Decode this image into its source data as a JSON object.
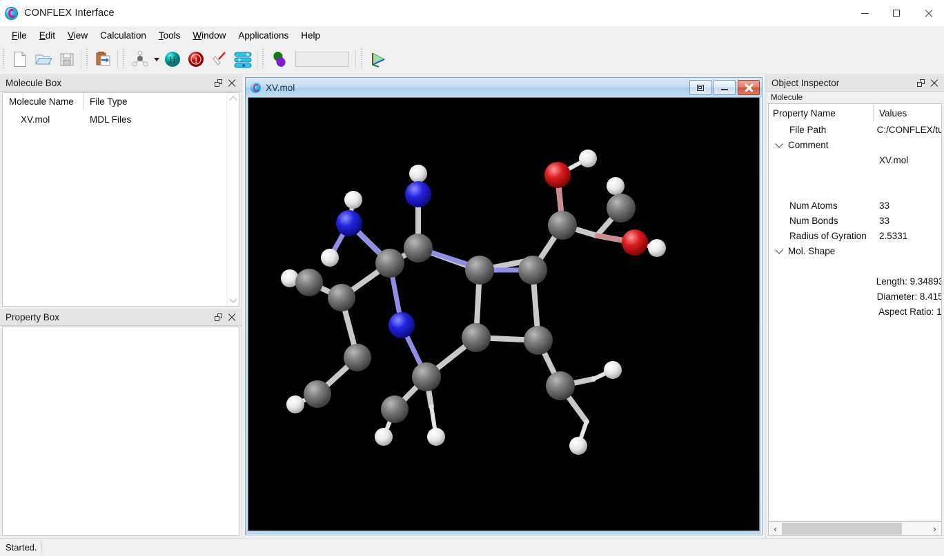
{
  "window": {
    "title": "CONFLEX Interface",
    "logo_icon": "conflex-c-logo-icon",
    "controls": {
      "minimize": "minimize-icon",
      "maximize": "maximize-icon",
      "close": "close-icon"
    }
  },
  "menubar": {
    "items": [
      {
        "label": "File",
        "mnemonic": "F"
      },
      {
        "label": "Edit",
        "mnemonic": "E"
      },
      {
        "label": "View",
        "mnemonic": "V"
      },
      {
        "label": "Calculation",
        "mnemonic": ""
      },
      {
        "label": "Tools",
        "mnemonic": "T"
      },
      {
        "label": "Window",
        "mnemonic": "W"
      },
      {
        "label": "Applications",
        "mnemonic": ""
      },
      {
        "label": "Help",
        "mnemonic": ""
      }
    ]
  },
  "toolbar": {
    "buttons": [
      {
        "name": "new-file-button",
        "icon": "new-document-icon"
      },
      {
        "name": "open-file-button",
        "icon": "open-folder-icon"
      },
      {
        "name": "save-file-button",
        "icon": "floppy-disk-save-icon"
      },
      {
        "name": "import-button",
        "icon": "import-clipboard-icon"
      },
      {
        "name": "molecule-model-button",
        "icon": "ball-stick-molecule-icon"
      },
      {
        "name": "hydrogen-button",
        "icon": "hydrogen-atom-icon",
        "glyph": "H"
      },
      {
        "name": "atom-number-button",
        "icon": "numbered-atom-icon",
        "glyph": "1"
      },
      {
        "name": "measure-button",
        "icon": "pencil-measure-icon"
      },
      {
        "name": "layers-button",
        "icon": "stacked-layers-icon"
      },
      {
        "name": "orbital-button",
        "icon": "molecular-orbital-icon"
      },
      {
        "name": "axes-button",
        "icon": "coordinate-axes-icon"
      }
    ],
    "dropdown_icon": "chevron-down-icon",
    "text_field": {
      "value": "",
      "placeholder": ""
    }
  },
  "molecule_box": {
    "title": "Molecule Box",
    "float_icon": "float-panel-icon",
    "close_icon": "close-icon",
    "columns": [
      "Molecule Name",
      "File Type"
    ],
    "rows": [
      {
        "name": "XV.mol",
        "type": "MDL Files"
      }
    ],
    "scrollbar": {
      "up_icon": "chevron-up-icon",
      "down_icon": "chevron-down-icon"
    }
  },
  "property_box": {
    "title": "Property Box",
    "float_icon": "float-panel-icon",
    "close_icon": "close-icon",
    "content": ""
  },
  "mdi_child": {
    "title": "XV.mol",
    "icon": "conflex-c-logo-icon",
    "restore_icon": "restore-window-icon",
    "minimize_icon": "minimize-icon",
    "close_icon": "close-icon",
    "viewport_background": "#000000"
  },
  "molecule_view": {
    "background": "#000000",
    "atom_colors": {
      "carbon": "#6e6e6e",
      "nitrogen": "#1a1ad8",
      "oxygen": "#cc1414",
      "hydrogen": "#f2f2f2"
    },
    "bond_color": "#c9c9c9",
    "style": "ball-and-stick"
  },
  "object_inspector": {
    "title": "Object Inspector",
    "float_icon": "float-panel-icon",
    "close_icon": "close-icon",
    "subheader": "Molecule",
    "columns": [
      "Property Name",
      "Values"
    ],
    "rows": [
      {
        "name": "File Path",
        "value": "C:/CONFLEX/tu",
        "indent": true,
        "expandable": false
      },
      {
        "name": "Comment",
        "value": "",
        "indent": true,
        "expandable": true
      },
      {
        "name": "",
        "value": "XV.mol",
        "indent": true,
        "expandable": false
      },
      {
        "name": "",
        "value": "",
        "indent": true,
        "expandable": false
      },
      {
        "name": "",
        "value": "",
        "indent": true,
        "expandable": false
      },
      {
        "name": "Num Atoms",
        "value": "33",
        "indent": true,
        "expandable": false
      },
      {
        "name": "Num Bonds",
        "value": "33",
        "indent": true,
        "expandable": false
      },
      {
        "name": "Radius of Gyration",
        "value": "2.5331",
        "indent": true,
        "expandable": false
      },
      {
        "name": "Mol. Shape",
        "value": "",
        "indent": true,
        "expandable": true
      },
      {
        "name": "",
        "value": "",
        "indent": true,
        "expandable": false
      },
      {
        "name": "",
        "value": "Length: 9.34893",
        "indent": true,
        "expandable": false
      },
      {
        "name": "",
        "value": "Diameter: 8.415",
        "indent": true,
        "expandable": false
      },
      {
        "name": "",
        "value": "Aspect Ratio: 1",
        "indent": true,
        "expandable": false
      }
    ],
    "hscrollbar": {
      "left_icon": "chevron-left-icon",
      "right_icon": "chevron-right-icon",
      "left_glyph": "‹",
      "right_glyph": "›"
    }
  },
  "statusbar": {
    "message": "Started."
  }
}
